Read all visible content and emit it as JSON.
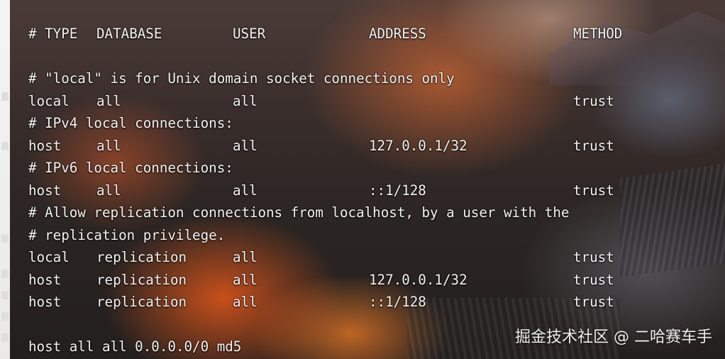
{
  "terminal": {
    "header": {
      "type": "# TYPE",
      "database": "DATABASE",
      "user": "USER",
      "address": "ADDRESS",
      "method": "METHOD"
    },
    "comment_local": "# \"local\" is for Unix domain socket connections only",
    "row_local_all": {
      "type": "local",
      "database": "all",
      "user": "all",
      "address": "",
      "method": "trust"
    },
    "comment_ipv4": "# IPv4 local connections:",
    "row_host_ipv4": {
      "type": "host",
      "database": "all",
      "user": "all",
      "address": "127.0.0.1/32",
      "method": "trust"
    },
    "comment_ipv6": "# IPv6 local connections:",
    "row_host_ipv6": {
      "type": "host",
      "database": "all",
      "user": "all",
      "address": "::1/128",
      "method": "trust"
    },
    "comment_replication_1": "# Allow replication connections from localhost, by a user with the",
    "comment_replication_2": "# replication privilege.",
    "row_repl_local": {
      "type": "local",
      "database": "replication",
      "user": "all",
      "address": "",
      "method": "trust"
    },
    "row_repl_ipv4": {
      "type": "host",
      "database": "replication",
      "user": "all",
      "address": "127.0.0.1/32",
      "method": "trust"
    },
    "row_repl_ipv6": {
      "type": "host",
      "database": "replication",
      "user": "all",
      "address": "::1/128",
      "method": "trust"
    },
    "custom_line": "host all all 0.0.0.0/0 md5"
  },
  "watermark": "掘金技术社区 @ 二哈赛车手",
  "colors": {
    "text": "#f4f4f4",
    "background_dark": "#2b2523",
    "accent_orange": "#ff6a1f"
  }
}
